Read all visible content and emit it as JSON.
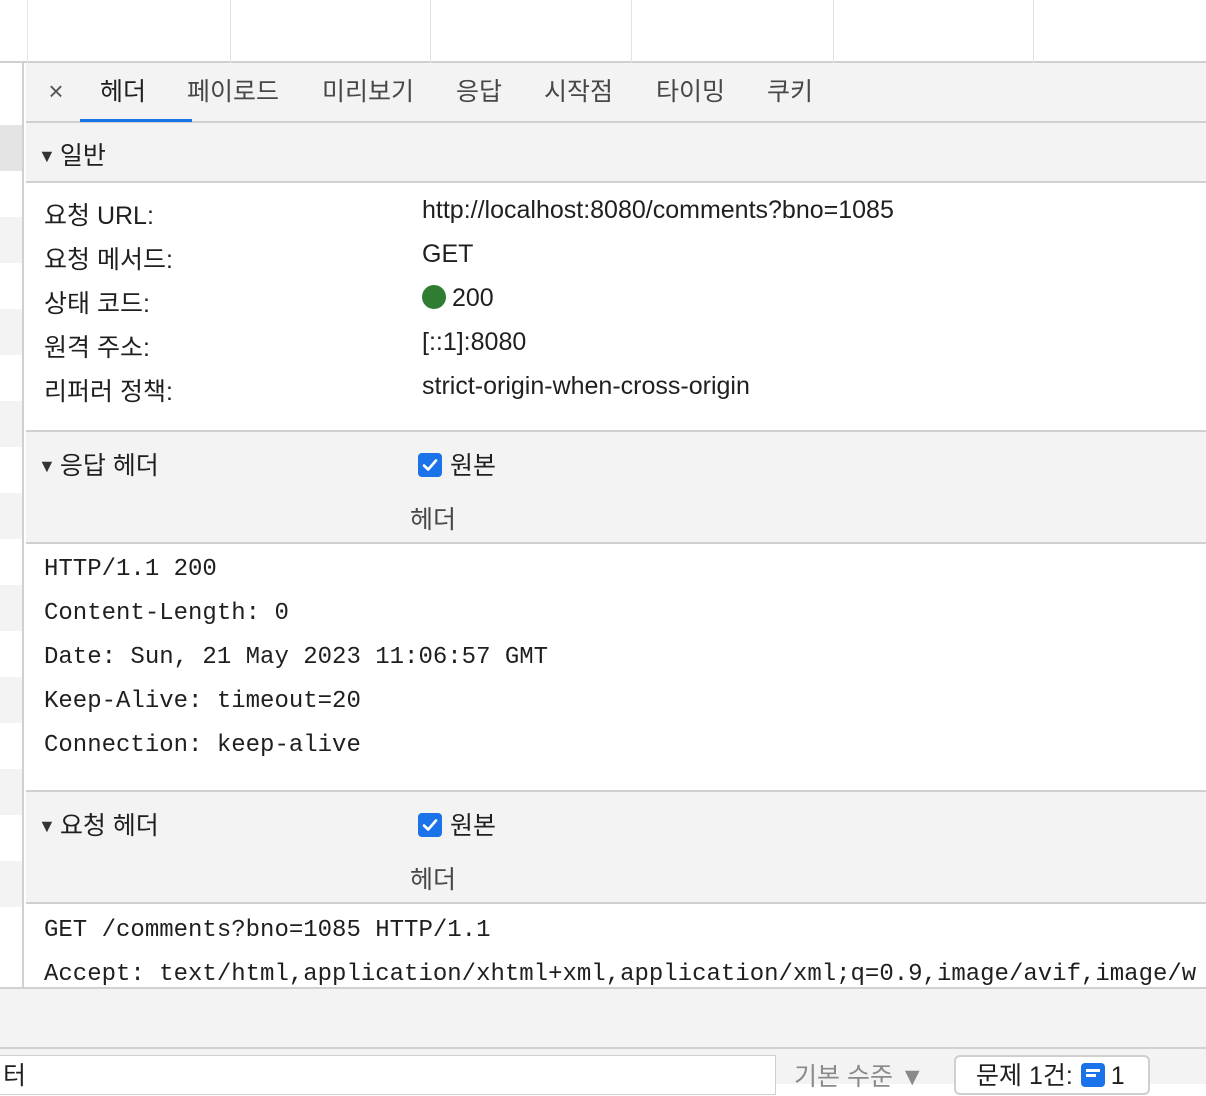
{
  "tabs": {
    "close_label": "×",
    "items": [
      "헤더",
      "페이로드",
      "미리보기",
      "응답",
      "시작점",
      "타이밍",
      "쿠키"
    ],
    "active_index": 0
  },
  "general": {
    "section_title": "일반",
    "rows": [
      {
        "label": "요청 URL:",
        "value": "http://localhost:8080/comments?bno=1085"
      },
      {
        "label": "요청 메서드:",
        "value": "GET"
      },
      {
        "label": "상태 코드:",
        "value": "200",
        "status_color": "#2e7d32"
      },
      {
        "label": "원격 주소:",
        "value": "[::1]:8080"
      },
      {
        "label": "리퍼러 정책:",
        "value": "strict-origin-when-cross-origin"
      }
    ]
  },
  "response_headers": {
    "section_title": "응답 헤더",
    "raw_label": "원본",
    "raw_checked": true,
    "raw_sub": "헤더",
    "lines": [
      "HTTP/1.1 200",
      "Content-Length: 0",
      "Date: Sun, 21 May 2023 11:06:57 GMT",
      "Keep-Alive: timeout=20",
      "Connection: keep-alive"
    ]
  },
  "request_headers": {
    "section_title": "요청 헤더",
    "raw_label": "원본",
    "raw_checked": true,
    "raw_sub": "헤더",
    "lines": [
      "GET /comments?bno=1085 HTTP/1.1",
      "Accept: text/html,application/xhtml+xml,application/xml;q=0.9,image/avif,image/w"
    ]
  },
  "drawer": {
    "filter_value": "터",
    "level_label": "기본 수준 ▼",
    "issues_label": "문제 1건:",
    "issues_count": "1"
  },
  "colors": {
    "accent": "#1a73e8",
    "status_ok": "#2e7d32"
  }
}
